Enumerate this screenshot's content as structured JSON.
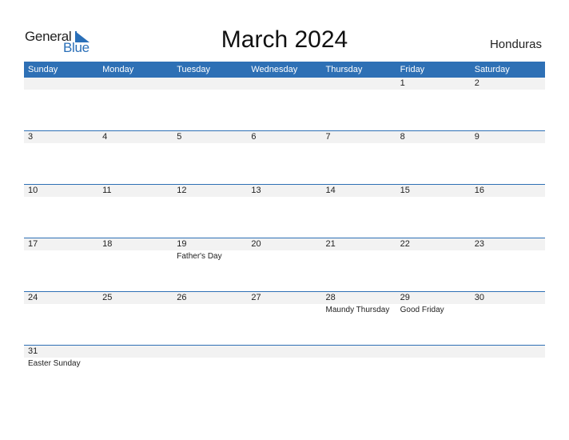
{
  "logo": {
    "word1": "General",
    "word2": "Blue"
  },
  "title": "March 2024",
  "country": "Honduras",
  "colors": {
    "accent": "#2e70b5",
    "band": "#f2f2f2"
  },
  "weekdays": [
    "Sunday",
    "Monday",
    "Tuesday",
    "Wednesday",
    "Thursday",
    "Friday",
    "Saturday"
  ],
  "weeks": [
    [
      {
        "day": ""
      },
      {
        "day": ""
      },
      {
        "day": ""
      },
      {
        "day": ""
      },
      {
        "day": ""
      },
      {
        "day": "1"
      },
      {
        "day": "2"
      }
    ],
    [
      {
        "day": "3"
      },
      {
        "day": "4"
      },
      {
        "day": "5"
      },
      {
        "day": "6"
      },
      {
        "day": "7"
      },
      {
        "day": "8"
      },
      {
        "day": "9"
      }
    ],
    [
      {
        "day": "10"
      },
      {
        "day": "11"
      },
      {
        "day": "12"
      },
      {
        "day": "13"
      },
      {
        "day": "14"
      },
      {
        "day": "15"
      },
      {
        "day": "16"
      }
    ],
    [
      {
        "day": "17"
      },
      {
        "day": "18"
      },
      {
        "day": "19",
        "event": "Father's Day"
      },
      {
        "day": "20"
      },
      {
        "day": "21"
      },
      {
        "day": "22"
      },
      {
        "day": "23"
      }
    ],
    [
      {
        "day": "24"
      },
      {
        "day": "25"
      },
      {
        "day": "26"
      },
      {
        "day": "27"
      },
      {
        "day": "28",
        "event": "Maundy Thursday"
      },
      {
        "day": "29",
        "event": "Good Friday"
      },
      {
        "day": "30"
      }
    ],
    [
      {
        "day": "31",
        "event": "Easter Sunday"
      },
      {
        "day": ""
      },
      {
        "day": ""
      },
      {
        "day": ""
      },
      {
        "day": ""
      },
      {
        "day": ""
      },
      {
        "day": ""
      }
    ]
  ]
}
